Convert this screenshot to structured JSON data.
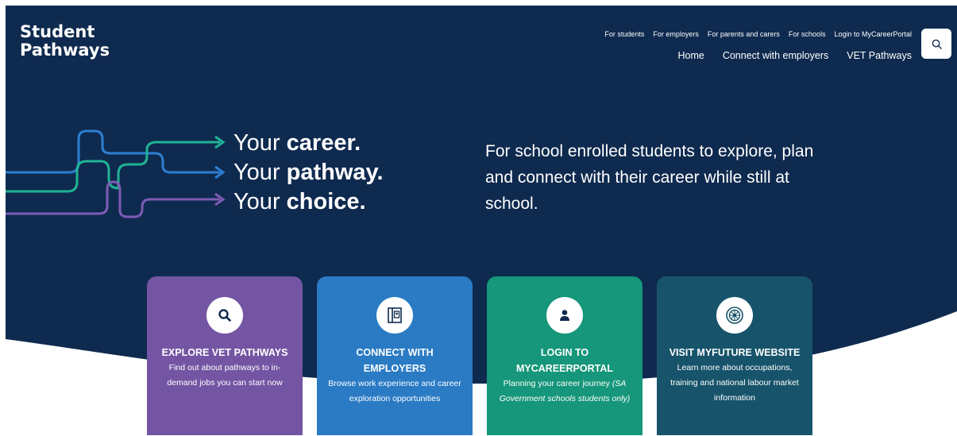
{
  "brand": {
    "line1": "Student",
    "line2": "Pathways"
  },
  "top_links": [
    "For students",
    "For employers",
    "For parents and carers",
    "For schools",
    "Login to MyCareerPortal"
  ],
  "main_nav": [
    "Home",
    "Connect with employers",
    "VET Pathways"
  ],
  "search": {
    "icon": "search-icon"
  },
  "taglines": [
    {
      "lead": "Your ",
      "strong": "career."
    },
    {
      "lead": "Your ",
      "strong": "pathway."
    },
    {
      "lead": "Your ",
      "strong": "choice."
    }
  ],
  "intro": "For school enrolled students to explore, plan and connect with their career while still at school.",
  "cards": [
    {
      "icon": "search-icon",
      "title": "EXPLORE VET PATHWAYS",
      "desc": "Find out about pathways to in-demand jobs you can start now",
      "desc_italic": ""
    },
    {
      "icon": "portfolio-icon",
      "title": "CONNECT WITH EMPLOYERS",
      "desc": "Browse work experience and career exploration opportunities",
      "desc_italic": ""
    },
    {
      "icon": "user-icon",
      "title": "LOGIN TO MYCAREERPORTAL",
      "desc": "Planning your career journey ",
      "desc_italic": "(SA Government schools students only)"
    },
    {
      "icon": "myfuture-logo-icon",
      "title": "VISIT MYFUTURE WEBSITE",
      "desc": "Learn more about occupations, training and national labour market information",
      "desc_italic": ""
    }
  ],
  "colors": {
    "hero_bg": "#0f2a4f",
    "line_blue": "#2d7fd0",
    "line_green": "#1fb394",
    "line_purple": "#7c5cb5",
    "card_purple": "#7455a3",
    "card_blue": "#2a7bc4",
    "card_green": "#16967a",
    "card_teal": "#17546b"
  }
}
